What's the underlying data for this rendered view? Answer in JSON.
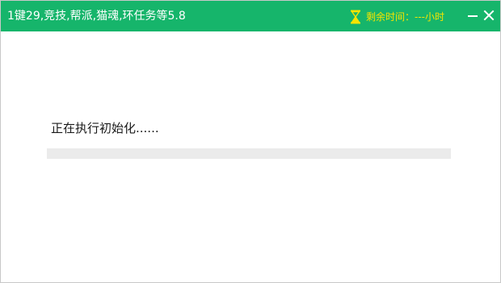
{
  "window": {
    "title": "1键29,竞技,帮派,猫魂,环任务等5.8",
    "timer_label": "剩余时间：---小时",
    "accent_color": "#16b56b",
    "timer_color": "#f5e400",
    "icons": {
      "timer": "hourglass-icon",
      "minimize": "minimize-icon",
      "close": "close-icon"
    }
  },
  "main": {
    "status_text": "正在执行初始化......",
    "progress": 0
  }
}
